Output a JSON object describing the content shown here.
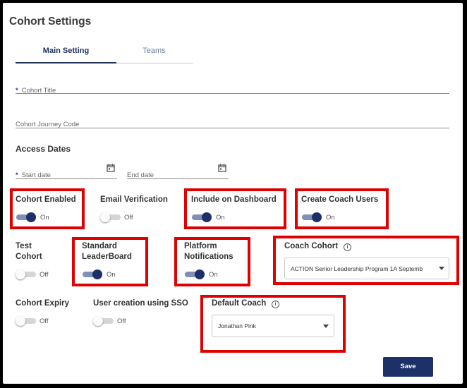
{
  "page": {
    "title": "Cohort Settings"
  },
  "tabs": [
    {
      "label": "Main Setting",
      "active": true
    },
    {
      "label": "Teams",
      "active": false
    }
  ],
  "fields": {
    "cohort_title": {
      "label": "Cohort Title",
      "required_mark": "*"
    },
    "journey_code": {
      "label": "Cohort Journey Code"
    },
    "access_dates_heading": "Access Dates",
    "start_date": {
      "label": "Start date",
      "required_mark": "*"
    },
    "end_date": {
      "label": "End date"
    }
  },
  "toggles": {
    "cohort_enabled": {
      "label": "Cohort Enabled",
      "state": "On"
    },
    "email_verification": {
      "label": "Email Verification",
      "state": "Off"
    },
    "include_dashboard": {
      "label": "Include on Dashboard",
      "state": "On"
    },
    "create_coach_users": {
      "label": "Create Coach Users",
      "state": "On"
    },
    "test_cohort": {
      "label_line1": "Test",
      "label_line2": "Cohort",
      "state": "Off"
    },
    "standard_leaderboard": {
      "label_line1": "Standard",
      "label_line2": "LeaderBoard",
      "state": "On"
    },
    "platform_notifications": {
      "label_line1": "Platform",
      "label_line2": "Notifications",
      "state": "On"
    },
    "cohort_expiry": {
      "label": "Cohort Expiry",
      "state": "Off"
    },
    "user_creation_sso": {
      "label": "User creation using SSO",
      "state": "Off"
    }
  },
  "coach_cohort": {
    "label": "Coach Cohort",
    "value": "ACTION Senior Leadership Program 1A Septemb"
  },
  "default_coach": {
    "label": "Default Coach",
    "value": "Jonathan Pink"
  },
  "icons": {
    "calendar": "calendar-icon",
    "info": "info-icon",
    "dropdown": "chevron-down-icon"
  },
  "actions": {
    "save": "Save"
  },
  "colors": {
    "primary": "#1d3168",
    "highlight": "#e00000",
    "toggle_track_on": "#7f8fb5"
  }
}
